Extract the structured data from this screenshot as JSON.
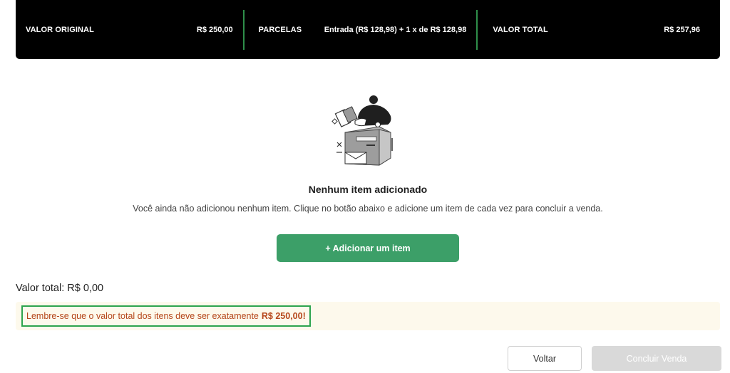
{
  "summary": {
    "original_label": "VALOR ORIGINAL",
    "original_value": "R$ 250,00",
    "installments_label": "PARCELAS",
    "installments_value": "Entrada (R$ 128,98) + 1 x de R$ 128,98",
    "total_label": "VALOR TOTAL",
    "total_value": "R$ 257,96"
  },
  "empty_state": {
    "illustration": "person-unpacking-box-illustration",
    "title": "Nenhum item adicionado",
    "description": "Você ainda não adicionou nenhum item. Clique no botão abaixo e adicione um item de cada vez para concluir a venda."
  },
  "actions": {
    "add_item_label": "+ Adicionar um item",
    "back_label": "Voltar",
    "finish_label": "Concluir Venda"
  },
  "total": {
    "label": "Valor total:",
    "amount": "R$ 0,00"
  },
  "warning": {
    "text": "Lembre-se que o valor total dos itens deve ser exatamente",
    "amount": "R$ 250,00!"
  },
  "colors": {
    "accent_green": "#3c9f68",
    "divider_green": "#2f8f4a",
    "warning_text": "#b5461a",
    "warning_bg": "#fdf9ec"
  }
}
